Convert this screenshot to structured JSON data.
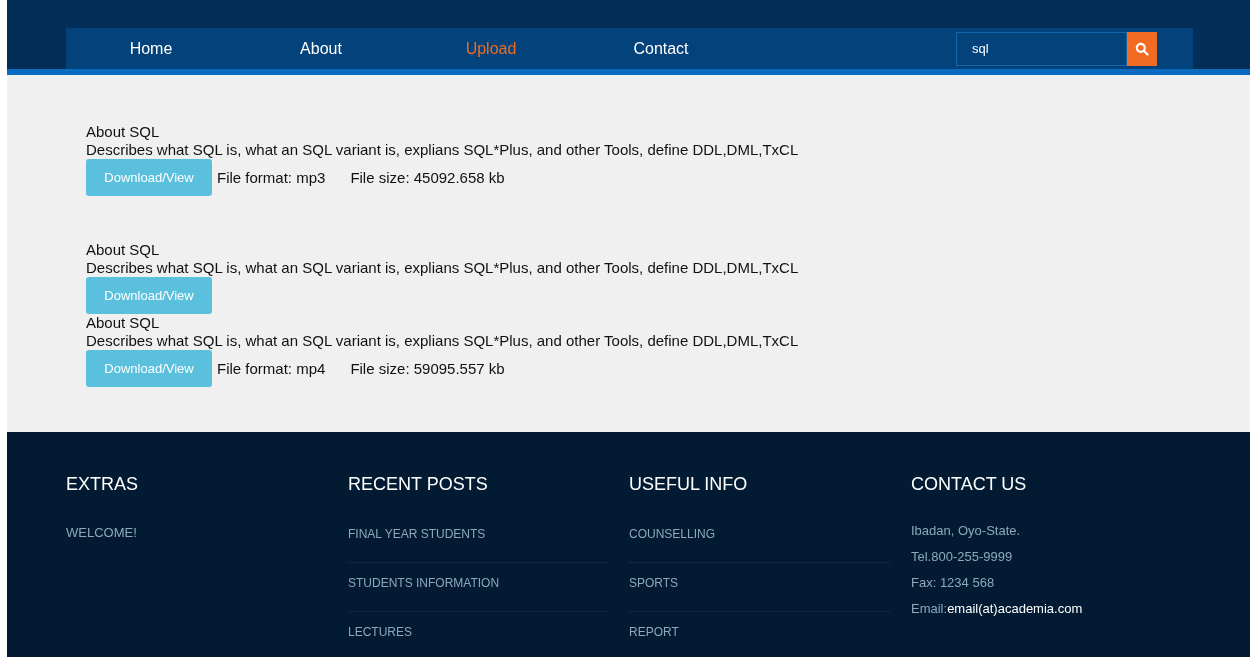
{
  "nav": {
    "items": [
      {
        "label": "Home",
        "selected": false
      },
      {
        "label": "About",
        "selected": false
      },
      {
        "label": "Upload",
        "selected": true
      },
      {
        "label": "Contact",
        "selected": false
      }
    ],
    "search": {
      "value": "sql"
    }
  },
  "results": [
    {
      "title": "About SQL",
      "description": "Describes what SQL is, what an SQL variant is, explians SQL*Plus, and other Tools, define DDL,DML,TxCL",
      "button": "Download/View",
      "format": "File format: mp3",
      "size": "File size: 45092.658 kb"
    },
    {
      "title": "About SQL",
      "description": "Describes what SQL is, what an SQL variant is, explians SQL*Plus, and other Tools, define DDL,DML,TxCL",
      "button": "Download/View"
    },
    {
      "title": "About SQL",
      "description": "Describes what SQL is, what an SQL variant is, explians SQL*Plus, and other Tools, define DDL,DML,TxCL",
      "button": "Download/View",
      "format": "File format: mp4",
      "size": "File size: 59095.557 kb"
    }
  ],
  "footer": {
    "columns": [
      {
        "heading": "EXTRAS",
        "kind": "text",
        "items": [
          "WELCOME!"
        ]
      },
      {
        "heading": "RECENT POSTS",
        "kind": "links",
        "items": [
          "FINAL YEAR STUDENTS",
          "STUDENTS INFORMATION",
          "LECTURES"
        ]
      },
      {
        "heading": "USEFUL INFO",
        "kind": "links",
        "items": [
          "COUNSELLING",
          "SPORTS",
          "REPORT"
        ]
      },
      {
        "heading": "CONTACT US",
        "kind": "contact",
        "items": [
          "Ibadan, Oyo-State.",
          "Tel.800-255-9999",
          "Fax: 1234 568"
        ],
        "email": {
          "label": "Email:",
          "value": "email(at)academia.com"
        }
      }
    ]
  }
}
